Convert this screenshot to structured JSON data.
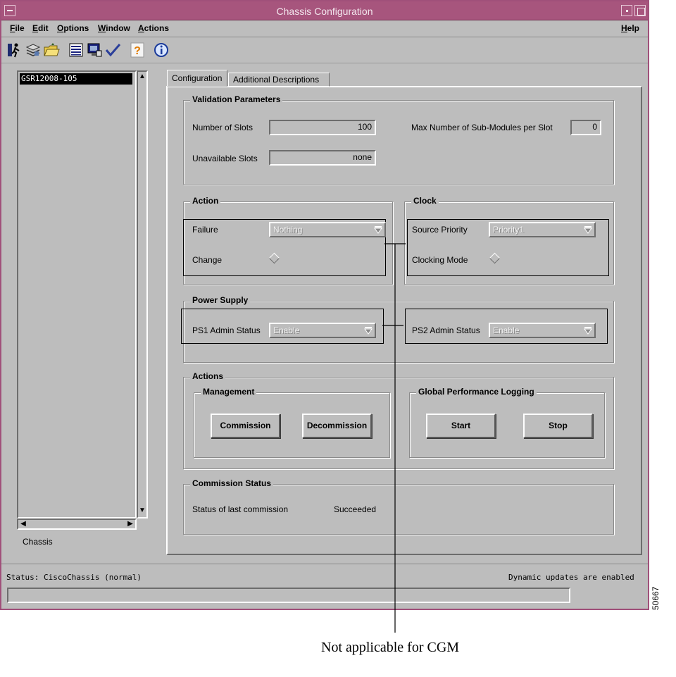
{
  "window": {
    "title": "Chassis Configuration"
  },
  "menubar": {
    "items": [
      "File",
      "Edit",
      "Options",
      "Window",
      "Actions"
    ],
    "help": "Help"
  },
  "toolbar": {
    "icons": [
      "exit-icon",
      "stack-icon",
      "open-folder-icon",
      "list-icon",
      "monitor-icon",
      "checkmark-icon",
      "question-icon",
      "info-icon"
    ]
  },
  "tree": {
    "selected_item": "GSR12008-105",
    "footer_label": "Chassis"
  },
  "tabs": [
    "Configuration",
    "Additional Descriptions"
  ],
  "validation": {
    "title": "Validation Parameters",
    "num_slots_label": "Number of Slots",
    "num_slots_value": "100",
    "max_sub_label": "Max Number of Sub-Modules per Slot",
    "max_sub_value": "0",
    "unavailable_label": "Unavailable Slots",
    "unavailable_value": "none"
  },
  "action": {
    "title": "Action",
    "failure_label": "Failure",
    "failure_value": "Nothing",
    "change_label": "Change"
  },
  "clock": {
    "title": "Clock",
    "source_label": "Source Priority",
    "source_value": "Priority1",
    "mode_label": "Clocking Mode"
  },
  "power": {
    "title": "Power Supply",
    "ps1_label": "PS1 Admin Status",
    "ps1_value": "Enable",
    "ps2_label": "PS2 Admin Status",
    "ps2_value": "Enable"
  },
  "actions": {
    "title": "Actions",
    "management_title": "Management",
    "commission": "Commission",
    "decommission": "Decommission",
    "logging_title": "Global Performance Logging",
    "start": "Start",
    "stop": "Stop"
  },
  "commission_status": {
    "title": "Commission Status",
    "label": "Status of last commission",
    "value": "Succeeded"
  },
  "status": {
    "left": "Status: CiscoChassis (normal)",
    "right": "Dynamic updates are enabled"
  },
  "annotation": {
    "callout": "Not applicable for CGM",
    "figure_id": "50667"
  },
  "colors": {
    "titlebar": "#a7557d",
    "window_bg": "#bdbdbd"
  }
}
